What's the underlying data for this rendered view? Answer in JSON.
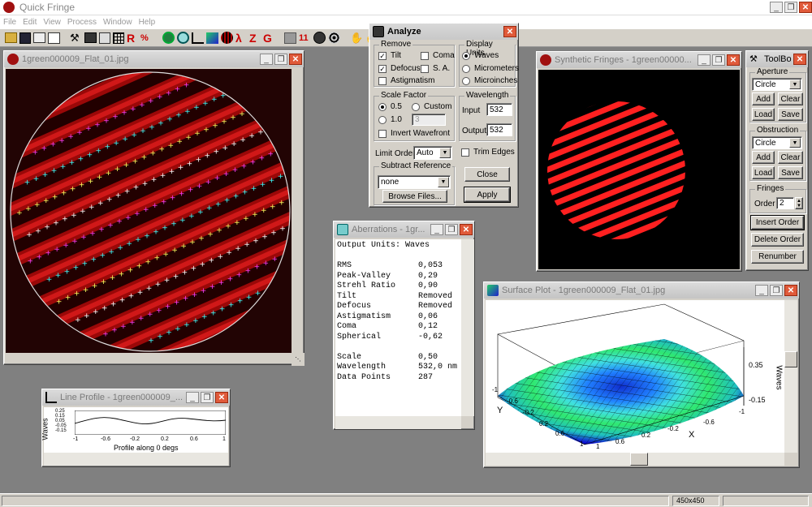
{
  "app": {
    "title": "Quick Fringe"
  },
  "menu": [
    "File",
    "Edit",
    "View",
    "Process",
    "Window",
    "Help"
  ],
  "status": {
    "size": "450x450"
  },
  "interferogram": {
    "title": "1green000009_Flat_01.jpg"
  },
  "synthetic": {
    "title": "Synthetic Fringes - 1green00000..."
  },
  "analyze": {
    "title": "Analyze",
    "remove": {
      "label": "Remove",
      "tilt": "Tilt",
      "defocus": "Defocus",
      "astigmatism": "Astigmatism",
      "coma": "Coma",
      "sa": "S. A."
    },
    "display_units": {
      "label": "Display Units",
      "waves": "Waves",
      "micrometers": "Micrometers",
      "microinches": "Microinches"
    },
    "scale": {
      "label": "Scale Factor",
      "v05": "0.5",
      "v10": "1.0",
      "custom": "Custom",
      "custom_value": "3",
      "invert": "Invert Wavefront"
    },
    "wavelength": {
      "label": "Wavelength",
      "input_label": "Input",
      "input_value": "532",
      "output_label": "Output",
      "output_value": "532"
    },
    "limit_order": {
      "label": "Limit Order",
      "value": "Auto"
    },
    "trim_edges": "Trim Edges",
    "subtract": {
      "label": "Subtract Reference",
      "value": "none",
      "browse": "Browse Files..."
    },
    "close": "Close",
    "apply": "Apply"
  },
  "toolbox": {
    "title": "ToolBox",
    "aperture": {
      "label": "Aperture",
      "value": "Circle",
      "add": "Add",
      "clear": "Clear",
      "load": "Load",
      "save": "Save"
    },
    "obstruction": {
      "label": "Obstruction",
      "value": "Circle",
      "add": "Add",
      "clear": "Clear",
      "load": "Load",
      "save": "Save"
    },
    "fringes": {
      "label": "Fringes",
      "order_label": "Order",
      "order_value": "2",
      "insert": "Insert Order",
      "delete": "Delete Order",
      "renumber": "Renumber"
    }
  },
  "aberrations": {
    "title": "Aberrations - 1gr...",
    "header": "Output Units: Waves",
    "rows": [
      {
        "k": "RMS",
        "v": "0,053"
      },
      {
        "k": "Peak-Valley",
        "v": "0,29"
      },
      {
        "k": "Strehl Ratio",
        "v": "0,90"
      },
      {
        "k": "Tilt",
        "v": "Removed"
      },
      {
        "k": "Defocus",
        "v": "Removed"
      },
      {
        "k": "Astigmatism",
        "v": "0,06"
      },
      {
        "k": "Coma",
        "v": "0,12"
      },
      {
        "k": "Spherical",
        "v": "-0,62"
      }
    ],
    "rows2": [
      {
        "k": "Scale",
        "v": "0,50"
      },
      {
        "k": "Wavelength",
        "v": "532,0 nm"
      },
      {
        "k": "Data Points",
        "v": "287"
      }
    ]
  },
  "line_profile": {
    "title": "Line Profile - 1green000009_...",
    "ylabel": "Waves",
    "yticks": [
      "0.25",
      "0.15",
      "0.05",
      "-0.05",
      "-0.15"
    ],
    "xticks": [
      "-1",
      "-0.6",
      "-0.2",
      "0.2",
      "0.6",
      "1"
    ],
    "xlabel": "Profile along 0 degs"
  },
  "surface": {
    "title": "Surface Plot - 1green000009_Flat_01.jpg",
    "zticks": [
      "0.35",
      "-0.15"
    ],
    "zlabel": "Waves",
    "xaxis": "X",
    "yaxis": "Y",
    "xticks": [
      "-1",
      "-0.6",
      "-0.2",
      "0.2",
      "0.6",
      "1"
    ],
    "yticks": [
      "1",
      "0.6",
      "0.2",
      "-0.2",
      "-0.6",
      "-1"
    ]
  }
}
